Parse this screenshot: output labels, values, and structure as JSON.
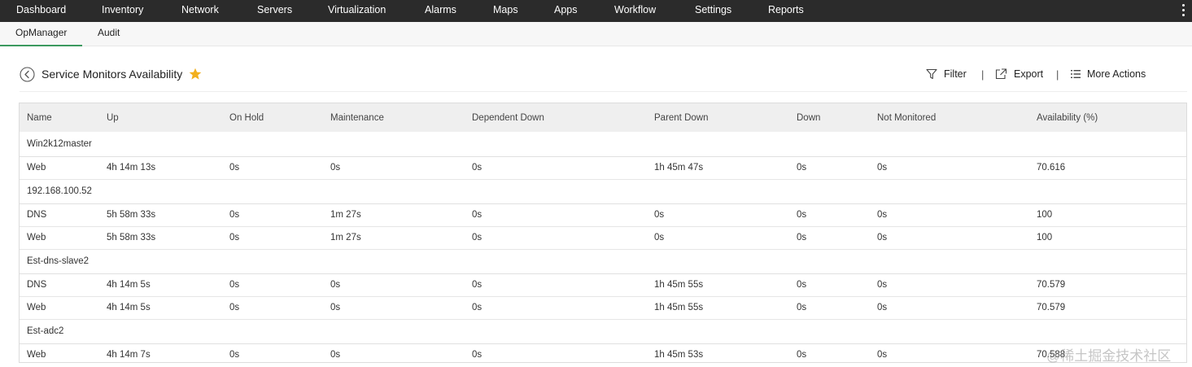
{
  "topnav": {
    "items": [
      "Dashboard",
      "Inventory",
      "Network",
      "Servers",
      "Virtualization",
      "Alarms",
      "Maps",
      "Apps",
      "Workflow",
      "Settings",
      "Reports"
    ]
  },
  "subnav": {
    "tabs": [
      "OpManager",
      "Audit"
    ],
    "active": "OpManager",
    "accent_color": "#3c9a5f"
  },
  "header": {
    "title": "Service Monitors Availability",
    "star_color": "#f2b01e",
    "actions": {
      "filter": "Filter",
      "export": "Export",
      "more": "More Actions"
    }
  },
  "table": {
    "columns": [
      "Name",
      "Up",
      "On Hold",
      "Maintenance",
      "Dependent Down",
      "Parent Down",
      "Down",
      "Not Monitored",
      "Availability (%)"
    ],
    "groups": [
      {
        "device": "Win2k12master",
        "rows": [
          [
            "Web",
            "4h 14m 13s",
            "0s",
            "0s",
            "0s",
            "1h 45m 47s",
            "0s",
            "0s",
            "70.616"
          ]
        ]
      },
      {
        "device": "192.168.100.52",
        "rows": [
          [
            "DNS",
            "5h 58m 33s",
            "0s",
            "1m 27s",
            "0s",
            "0s",
            "0s",
            "0s",
            "100"
          ],
          [
            "Web",
            "5h 58m 33s",
            "0s",
            "1m 27s",
            "0s",
            "0s",
            "0s",
            "0s",
            "100"
          ]
        ]
      },
      {
        "device": "Est-dns-slave2",
        "rows": [
          [
            "DNS",
            "4h 14m 5s",
            "0s",
            "0s",
            "0s",
            "1h 45m 55s",
            "0s",
            "0s",
            "70.579"
          ],
          [
            "Web",
            "4h 14m 5s",
            "0s",
            "0s",
            "0s",
            "1h 45m 55s",
            "0s",
            "0s",
            "70.579"
          ]
        ]
      },
      {
        "device": "Est-adc2",
        "rows": [
          [
            "Web",
            "4h 14m 7s",
            "0s",
            "0s",
            "0s",
            "1h 45m 53s",
            "0s",
            "0s",
            "70.588"
          ]
        ]
      }
    ]
  },
  "watermark": "@稀土掘金技术社区"
}
